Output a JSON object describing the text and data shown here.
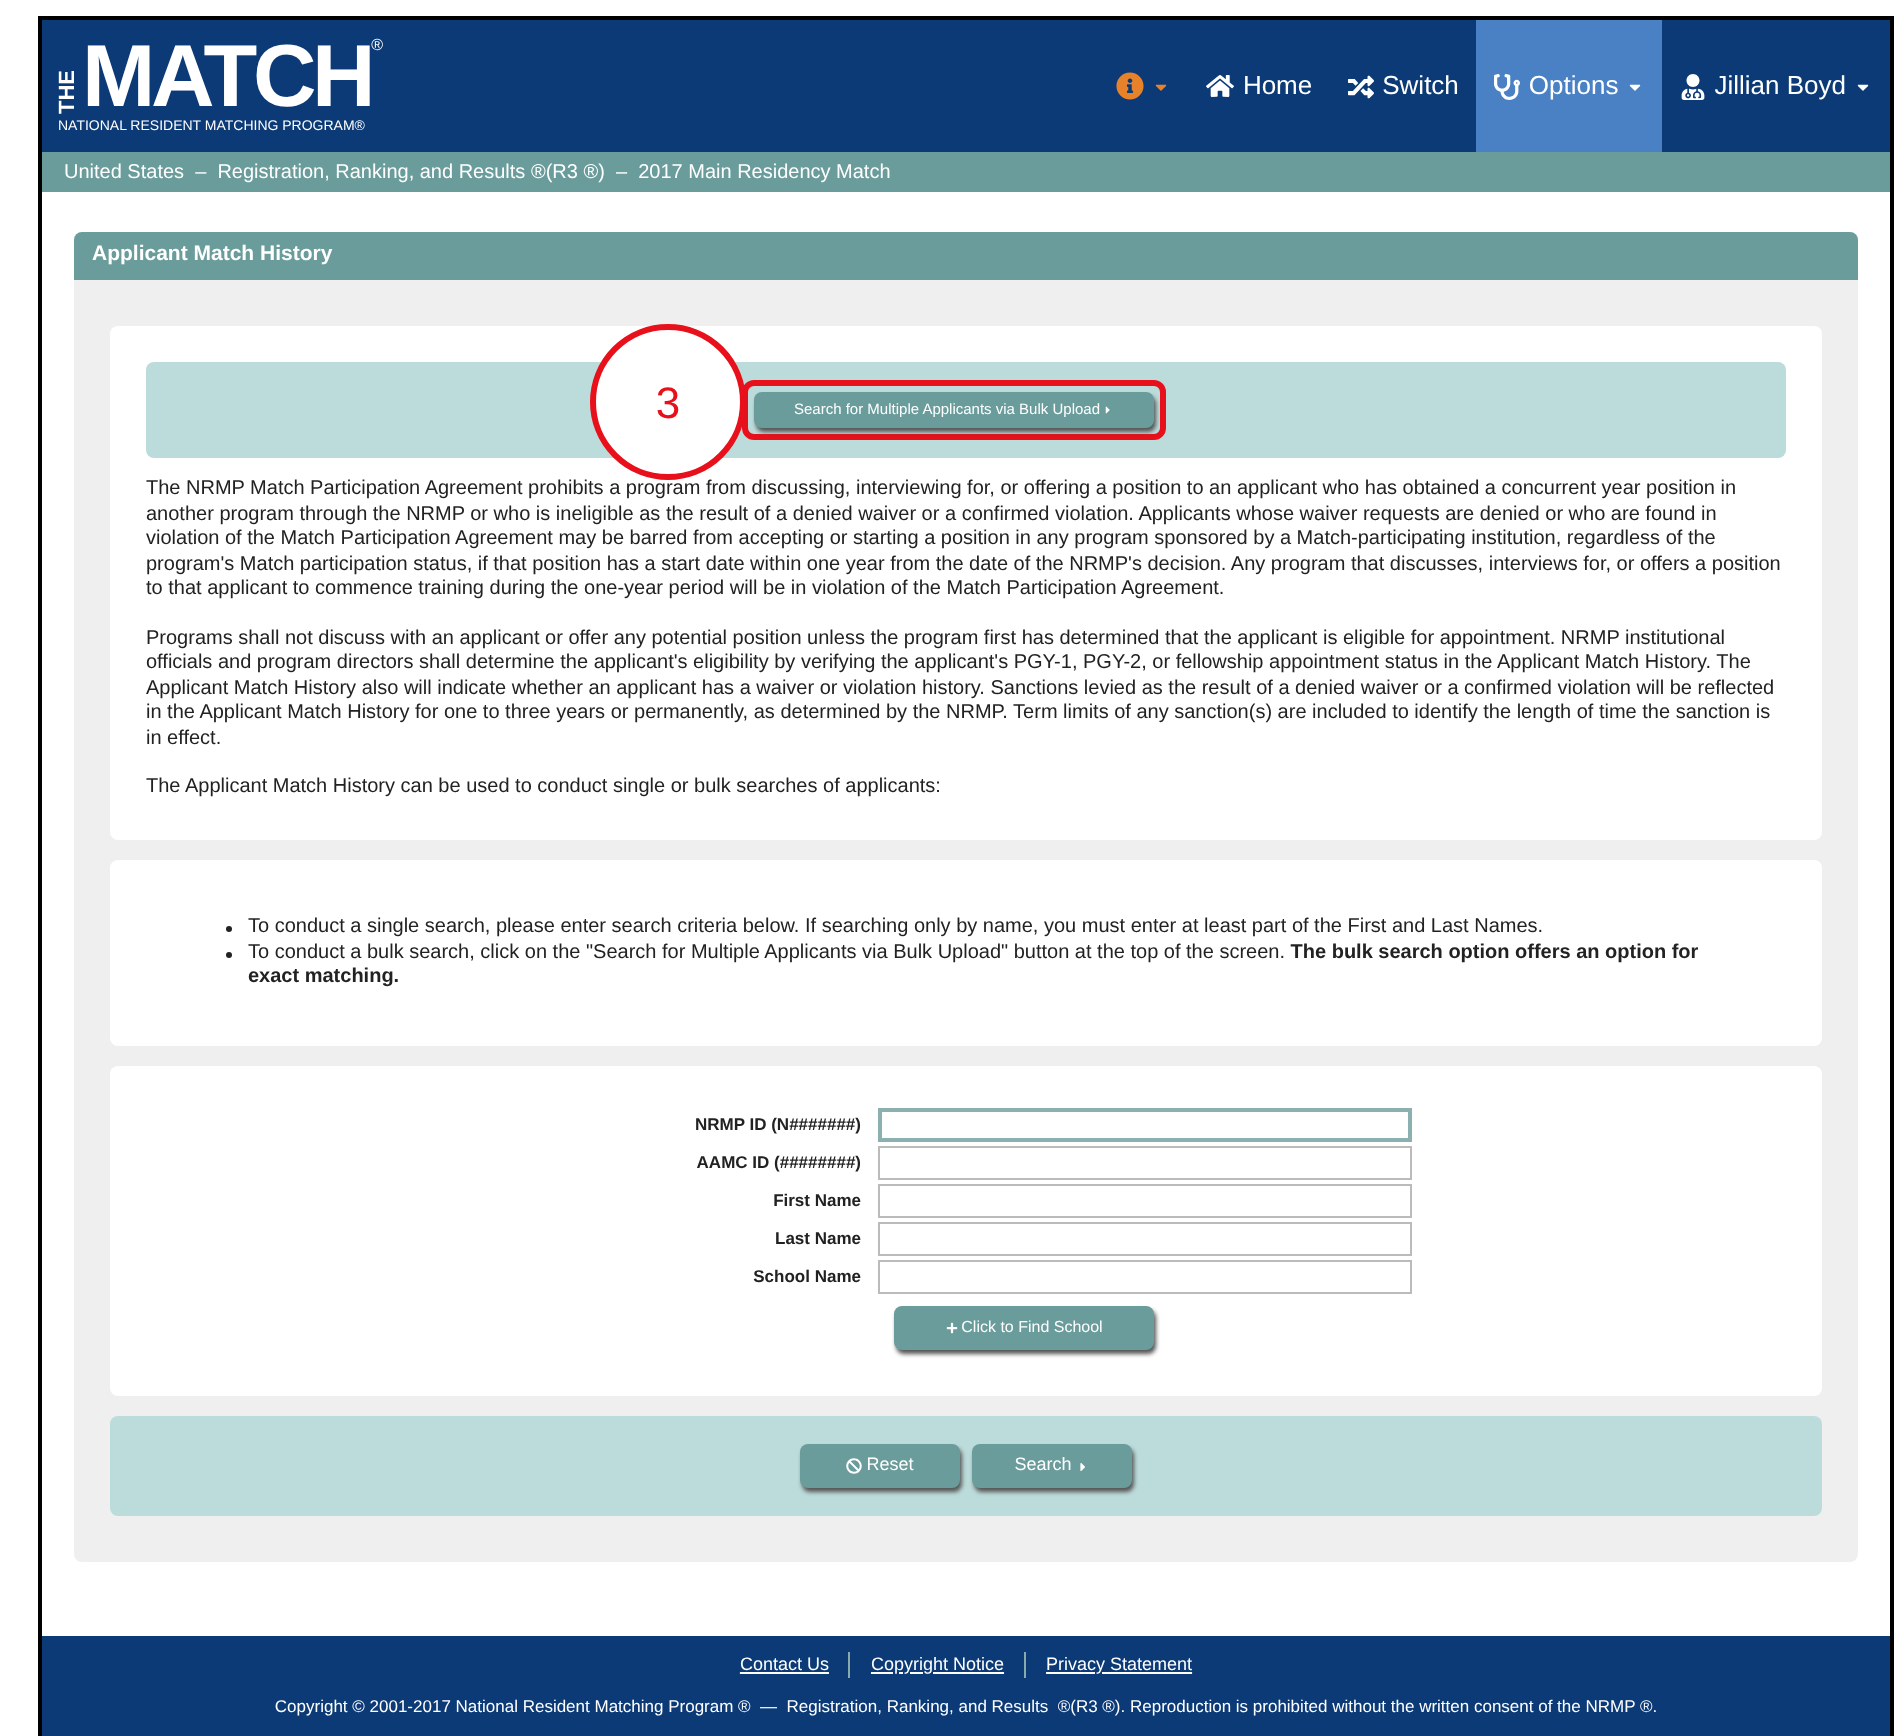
{
  "header": {
    "logo": {
      "vertical": "THE",
      "title": "MATCH",
      "mark": "®",
      "subtitle": "NATIONAL RESIDENT MATCHING PROGRAM®"
    },
    "nav": [
      {
        "kind": "info",
        "selected": false,
        "dropdown": true
      },
      {
        "kind": "home",
        "label": "Home",
        "selected": false,
        "dropdown": false
      },
      {
        "kind": "switch",
        "label": "Switch",
        "selected": false,
        "dropdown": false
      },
      {
        "kind": "options",
        "label": "Options",
        "selected": true,
        "dropdown": true
      },
      {
        "kind": "user",
        "label": "Jillian Boyd",
        "selected": false,
        "dropdown": true
      }
    ]
  },
  "breadcrumb": "United States  –  Registration, Ranking, and Results ®(R3 ®)  –  2017 Main Residency Match",
  "panel": {
    "title": "Applicant Match History",
    "bulk_button": "Search for Multiple Applicants via Bulk Upload",
    "callout": "3",
    "paragraphs": [
      "The NRMP Match Participation Agreement prohibits a program from discussing, interviewing for, or offering a position to an applicant who has obtained a concurrent year position in another program through the NRMP or who is ineligible as the result of a denied waiver or a confirmed violation. Applicants whose waiver requests are denied or who are found in violation of the Match Participation Agreement may be barred from accepting or starting a position in any program sponsored by a Match-participating institution, regardless of the program's Match participation status, if that position has a start date within one year from the date of the NRMP's decision. Any program that discusses, interviews for, or offers a position to that applicant to commence training during the one-year period will be in violation of the Match Participation Agreement.",
      "Programs shall not discuss with an applicant or offer any potential position unless the program first has determined that the applicant is eligible for appointment. NRMP institutional officials and program directors shall determine the applicant's eligibility by verifying the applicant's PGY-1, PGY-2, or fellowship appointment status in the Applicant Match History. The Applicant Match History also will indicate whether an applicant has a waiver or violation history. Sanctions levied as the result of a denied waiver or a confirmed violation will be reflected in the Applicant Match History for one to three years or permanently, as determined by the NRMP. Term limits of any sanction(s) are included to identify the length of time the sanction is in effect.",
      "The Applicant Match History can be used to conduct single or bulk searches of applicants:"
    ],
    "bullets": [
      "To conduct a single search, please enter search criteria below. If searching only by name, you must enter at least part of the First and Last Names.",
      "To conduct a bulk search, click on the \"Search for Multiple Applicants via Bulk Upload\" button at the top of the screen. **The bulk search option offers an option for exact matching.**"
    ],
    "fields": [
      {
        "label": "NRMP ID (N#######)",
        "focused": true
      },
      {
        "label": "AAMC ID (########)",
        "focused": false
      },
      {
        "label": "First Name",
        "focused": false
      },
      {
        "label": "Last Name",
        "focused": false
      },
      {
        "label": "School Name",
        "focused": false
      }
    ],
    "find_school_button": "Click to Find School",
    "reset_button": "Reset",
    "search_button": "Search"
  },
  "footer": {
    "links": [
      "Contact Us",
      "Copyright Notice",
      "Privacy Statement"
    ],
    "copyright": "Copyright © 2001-2017 National Resident Matching Program ®  —  Registration, Ranking, and Results  ®(R3 ®). Reproduction is prohibited without the written consent of the NRMP ®."
  }
}
